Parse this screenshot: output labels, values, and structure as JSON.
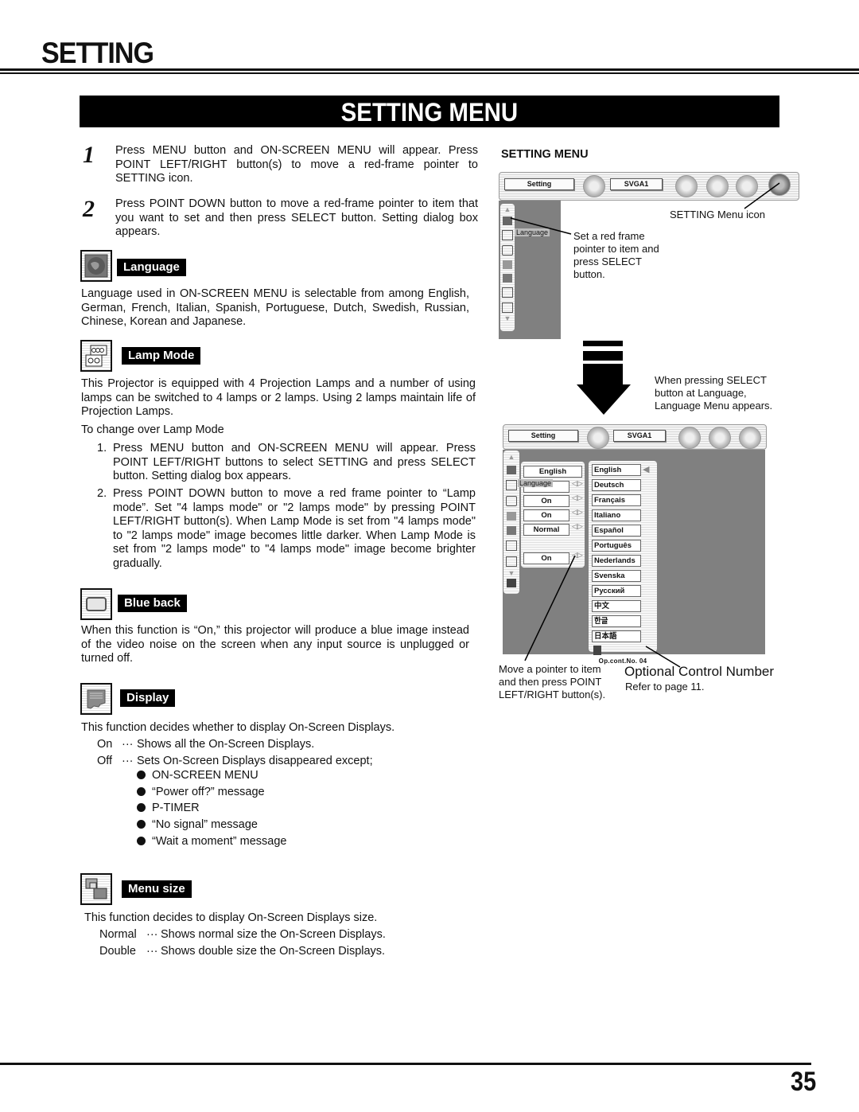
{
  "header": {
    "title": "SETTING",
    "banner": "SETTING MENU"
  },
  "steps": [
    {
      "number": "1",
      "text": "Press MENU button and ON-SCREEN MENU will appear.  Press POINT LEFT/RIGHT button(s) to move a red-frame pointer to SETTING icon."
    },
    {
      "number": "2",
      "text": "Press POINT DOWN button to move a red-frame pointer to item that you want to set and then press SELECT button.  Setting dialog box appears."
    }
  ],
  "sections": {
    "language": {
      "label": "Language",
      "icon": "globe-icon",
      "text": "Language used in ON-SCREEN MENU is selectable from among English, German, French, Italian, Spanish, Portuguese, Dutch, Swedish, Russian, Chinese, Korean and Japanese."
    },
    "lamp_mode": {
      "label": "Lamp Mode",
      "icon": "lamps-icon",
      "text": "This Projector is equipped with 4 Projection Lamps and a number of using lamps can be switched to 4 lamps or 2 lamps.  Using 2 lamps maintain life of Projection Lamps.",
      "subhead": "To change over Lamp Mode",
      "steps": [
        {
          "n": "1.",
          "text": "Press MENU button and ON-SCREEN MENU will appear.  Press POINT LEFT/RIGHT buttons to select SETTING and press SELECT button.  Setting dialog box appears."
        },
        {
          "n": "2.",
          "text": "Press POINT DOWN button to move a red frame pointer to “Lamp mode”.  Set \"4 lamps mode\" or \"2 lamps mode\" by pressing POINT LEFT/RIGHT button(s).  When Lamp Mode is set from \"4 lamps mode\" to \"2 lamps mode\" image becomes little darker.  When Lamp Mode is set from \"2 lamps mode\" to \"4 lamps mode\" image become brighter gradually."
        }
      ]
    },
    "blue_back": {
      "label": "Blue back",
      "icon": "screen-rectangle-icon",
      "text": "When this function is “On,” this projector will produce a blue image instead of the video noise on the screen when any input source is unplugged or turned off."
    },
    "display": {
      "label": "Display",
      "icon": "display-icon",
      "text": "This function decides whether to display On-Screen Displays.",
      "options": [
        {
          "key": "On",
          "sep": "···",
          "desc": "Shows all the On-Screen Displays."
        },
        {
          "key": "Off",
          "sep": "···",
          "desc": "Sets On-Screen Displays disappeared except;"
        }
      ],
      "exceptions": [
        "ON-SCREEN MENU",
        "“Power off?” message",
        "P-TIMER",
        "“No signal” message",
        "“Wait a moment” message"
      ]
    },
    "menu_size": {
      "label": "Menu size",
      "icon": "menu-size-icon",
      "text": "This function decides to display On-Screen Displays size.",
      "options": [
        {
          "key": "Normal",
          "sep": "···",
          "desc": "Shows normal size the On-Screen Displays."
        },
        {
          "key": "Double",
          "sep": "···",
          "desc": "Shows double size the On-Screen Displays."
        }
      ]
    }
  },
  "figure": {
    "heading": "SETTING MENU",
    "menu_bar": {
      "left_label": "Setting",
      "source_label": "SVGA1"
    },
    "pointer_label": "Language",
    "callouts": {
      "setting_icon": "SETTING Menu icon",
      "set_pointer": "Set a red frame pointer to item and press SELECT button.",
      "select_language": "When pressing SELECT button at Language, Language Menu appears.",
      "move_pointer": "Move a pointer to item and then press POINT LEFT/RIGHT button(s).",
      "opt_control_title": "Optional Control Number",
      "opt_control_ref": "Refer to page 11."
    },
    "setting_values": [
      "English",
      "",
      "On",
      "On",
      "Normal",
      "On"
    ],
    "languages": [
      "English",
      "Deutsch",
      "Français",
      "Italiano",
      "Español",
      "Português",
      "Nederlands",
      "Svenska",
      "Русский",
      "中文",
      "한글",
      "日本語"
    ],
    "op_cont_no": "Op.cont.No. 04"
  },
  "footer": {
    "page_number": "35"
  }
}
